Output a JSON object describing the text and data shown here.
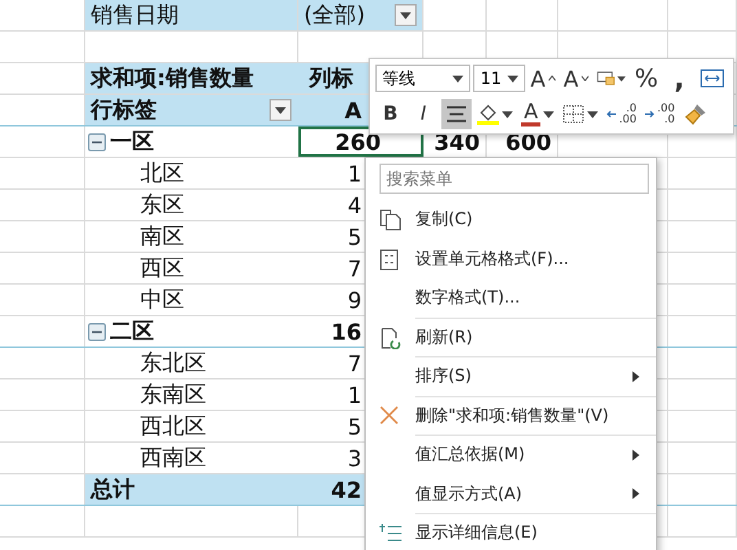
{
  "filter": {
    "label": "销售日期",
    "value": "(全部)"
  },
  "pivot": {
    "value_field": "求和项:销售数量",
    "column_label": "列标",
    "row_label": "行标签",
    "column_item": "A"
  },
  "groups": [
    {
      "label": "一区",
      "expanded": true,
      "value": "260",
      "selected": true,
      "extra": [
        "340",
        "600"
      ],
      "children": [
        {
          "label": "北区",
          "value": "1"
        },
        {
          "label": "东区",
          "value": "4"
        },
        {
          "label": "南区",
          "value": "5"
        },
        {
          "label": "西区",
          "value": "7"
        },
        {
          "label": "中区",
          "value": "9"
        }
      ]
    },
    {
      "label": "二区",
      "expanded": true,
      "value": "16",
      "selected": false,
      "children": [
        {
          "label": "东北区",
          "value": "7"
        },
        {
          "label": "东南区",
          "value": "1"
        },
        {
          "label": "西北区",
          "value": "5"
        },
        {
          "label": "西南区",
          "value": "3"
        }
      ]
    }
  ],
  "total": {
    "label": "总计",
    "value": "42"
  },
  "toolbar": {
    "row_1": [
      {
        "kind": "font",
        "value": "等线"
      },
      {
        "kind": "size",
        "value": "11"
      },
      {
        "kind": "grow",
        "label": "A"
      },
      {
        "kind": "shrink",
        "label": "A"
      },
      {
        "kind": "numformat"
      },
      {
        "kind": "percent",
        "label": "%"
      },
      {
        "kind": "comma",
        "label": ","
      },
      {
        "kind": "wrap"
      }
    ],
    "row_2": [
      {
        "kind": "bold",
        "label": "B",
        "selected": false
      },
      {
        "kind": "italic",
        "label": "I",
        "selected": false
      },
      {
        "kind": "align",
        "selected": true
      },
      {
        "kind": "fill",
        "color": "#ffff00"
      },
      {
        "kind": "fontcolor",
        "label": "A",
        "color": "#c0392b"
      },
      {
        "kind": "border"
      },
      {
        "kind": "incdec",
        "top": ".0",
        "bottom": ".00"
      },
      {
        "kind": "decdec",
        "top": ".00",
        "bottom": ".0"
      },
      {
        "kind": "painter"
      }
    ]
  },
  "menu": {
    "search": {
      "placeholder": "搜索菜单"
    },
    "items": [
      {
        "kind": "copy",
        "label": "复制(C)",
        "divider": false
      },
      {
        "kind": "format",
        "label": "设置单元格格式(F)...",
        "divider": false
      },
      {
        "kind": "plain",
        "label": "数字格式(T)...",
        "divider": false
      },
      {
        "kind": "refresh",
        "label": "刷新(R)",
        "divider": true
      },
      {
        "kind": "submenu",
        "label": "排序(S)",
        "divider": true
      },
      {
        "kind": "delete",
        "label": "删除\"求和项:销售数量\"(V)",
        "divider": true
      },
      {
        "kind": "submenu",
        "label": "值汇总依据(M)",
        "divider": true
      },
      {
        "kind": "submenu",
        "label": "值显示方式(A)",
        "divider": false
      },
      {
        "kind": "details",
        "label": "显示详细信息(E)",
        "divider": true
      }
    ]
  }
}
